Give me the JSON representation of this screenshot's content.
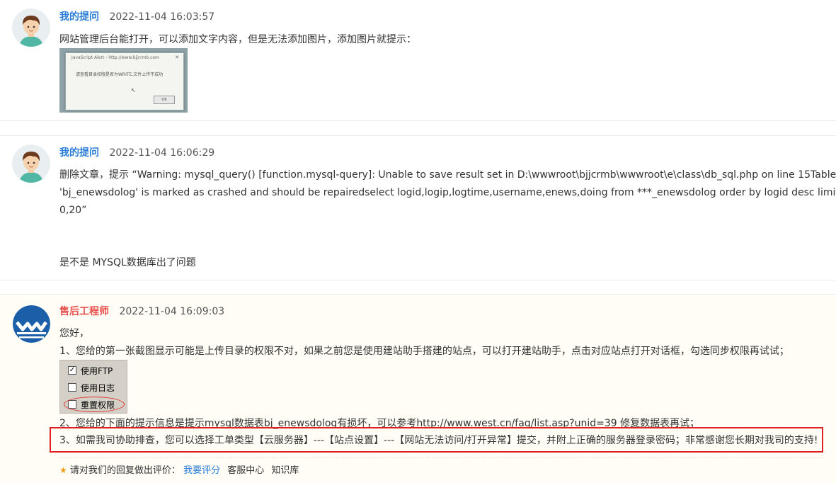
{
  "messages": [
    {
      "author": "我的提问",
      "time": "2022-11-04 16:03:57",
      "text": "网站管理后台能打开，可以添加文字内容，但是无法添加图片，添加图片就提示：",
      "screenshot": {
        "title": "JavaScript Alert - http://www.bjjcrmb.com",
        "message": "请查看目录权限是否为WRITE,文件上传不成功",
        "button": "OK"
      }
    },
    {
      "author": "我的提问",
      "time": "2022-11-04 16:06:29",
      "lines": [
        "删除文章，提示 “Warning: mysql_query() [function.mysql-query]: Unable to save result set in D:\\wwwroot\\bjjcrmb\\wwwroot\\e\\class\\db_sql.php on line 15Table",
        "'bj_enewsdolog' is marked as crashed and should be repairedselect logid,logip,logtime,username,enews,doing from ***_enewsdolog order by logid desc limit",
        "0,20”"
      ],
      "followup": "是不是 MYSQL数据库出了问题"
    },
    {
      "author": "售后工程师",
      "time": "2022-11-04 16:09:03",
      "greeting": "您好，",
      "point1": "1、您给的第一张截图显示可能是上传目录的权限不对，如果之前您是使用建站助手搭建的站点，可以打开建站助手，点击对应站点打开对话框，勾选同步权限再试试；",
      "options": [
        {
          "label": "使用FTP",
          "checked": true
        },
        {
          "label": "使用日志",
          "checked": false
        },
        {
          "label": "重置权限",
          "checked": false
        }
      ],
      "point2": "2、您给的下面的提示信息是提示mysql数据表bj_enewsdolog有损坏，可以参考http://www.west.cn/faq/list.asp?unid=39 修复数据表再试；",
      "point3": "3、如需我司协助排查，您可以选择工单类型【云服务器】---【站点设置】---【网站无法访问/打开异常】提交，并附上正确的服务器登录密码；非常感谢您长期对我司的支持!"
    }
  ],
  "rating": {
    "prompt": "请对我们的回复做出评价：",
    "rate_link": "我要评分",
    "service_center": "客服中心",
    "knowledge_base": "知识库"
  },
  "icons": {
    "star": "star-icon",
    "user_avatar": "user-avatar-icon",
    "engineer_logo": "west-logo-icon"
  },
  "colors": {
    "author_user": "#2b7dd6",
    "author_engineer": "#e8514d",
    "highlight_box": "#e02020",
    "engineer_bg": "#fffdf6"
  }
}
